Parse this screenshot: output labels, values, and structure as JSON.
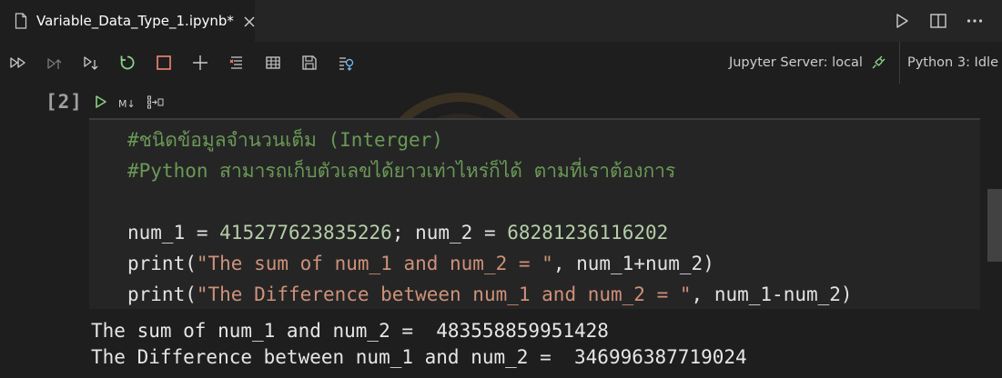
{
  "tab": {
    "title": "Variable_Data_Type_1.ipynb*",
    "icon": "file-icon",
    "close_icon": "close-icon"
  },
  "tab_actions": [
    {
      "name": "run-all-icon"
    },
    {
      "name": "split-editor-icon"
    },
    {
      "name": "more-actions-icon"
    }
  ],
  "toolbar": {
    "buttons": [
      "run-all-cells-icon",
      "run-above-icon",
      "run-below-icon",
      "restart-kernel-icon",
      "interrupt-kernel-icon",
      "add-cell-icon",
      "clear-outputs-icon",
      "variables-icon",
      "save-icon",
      "export-icon"
    ],
    "server_label": "Jupyter Server: local",
    "kernel_label": "Python 3: Idle"
  },
  "cell": {
    "exec_count": "[2]",
    "markdown_toggle": "M↓",
    "code_lines": [
      [
        {
          "t": "comment",
          "v": "#ชนิดข้อมูลจำนวนเต็ม (Interger)"
        }
      ],
      [
        {
          "t": "comment",
          "v": "#Python สามารถเก็บตัวเลขได้ยาวเท่าไหร่ก็ได้ ตามที่เราต้องการ"
        }
      ],
      [],
      [
        {
          "t": "var",
          "v": "num_1 "
        },
        {
          "t": "op",
          "v": "= "
        },
        {
          "t": "num",
          "v": "415277623835226"
        },
        {
          "t": "op",
          "v": "; "
        },
        {
          "t": "var",
          "v": "num_2 "
        },
        {
          "t": "op",
          "v": "= "
        },
        {
          "t": "num",
          "v": "68281236116202"
        }
      ],
      [
        {
          "t": "func",
          "v": "print"
        },
        {
          "t": "op",
          "v": "("
        },
        {
          "t": "str",
          "v": "\"The sum of num_1 and num_2 = \""
        },
        {
          "t": "op",
          "v": ", "
        },
        {
          "t": "var",
          "v": "num_1"
        },
        {
          "t": "op",
          "v": "+"
        },
        {
          "t": "var",
          "v": "num_2"
        },
        {
          "t": "op",
          "v": ")"
        }
      ],
      [
        {
          "t": "func",
          "v": "print"
        },
        {
          "t": "op",
          "v": "("
        },
        {
          "t": "str",
          "v": "\"The Difference between num_1 and num_2 = \""
        },
        {
          "t": "op",
          "v": ", "
        },
        {
          "t": "var",
          "v": "num_1"
        },
        {
          "t": "op",
          "v": "-"
        },
        {
          "t": "var",
          "v": "num_2"
        },
        {
          "t": "op",
          "v": ")"
        }
      ]
    ],
    "output_lines": [
      "The sum of num_1 and num_2 =  483558859951428",
      "The Difference between num_1 and num_2 =  346996387719024"
    ]
  },
  "colors": {
    "background": "#1e1e1e",
    "comment": "#6a9955",
    "string": "#ce9178",
    "number": "#b5cea8",
    "run_green": "#89d185",
    "restart_green": "#89d185",
    "interrupt_orange": "#f48771"
  }
}
